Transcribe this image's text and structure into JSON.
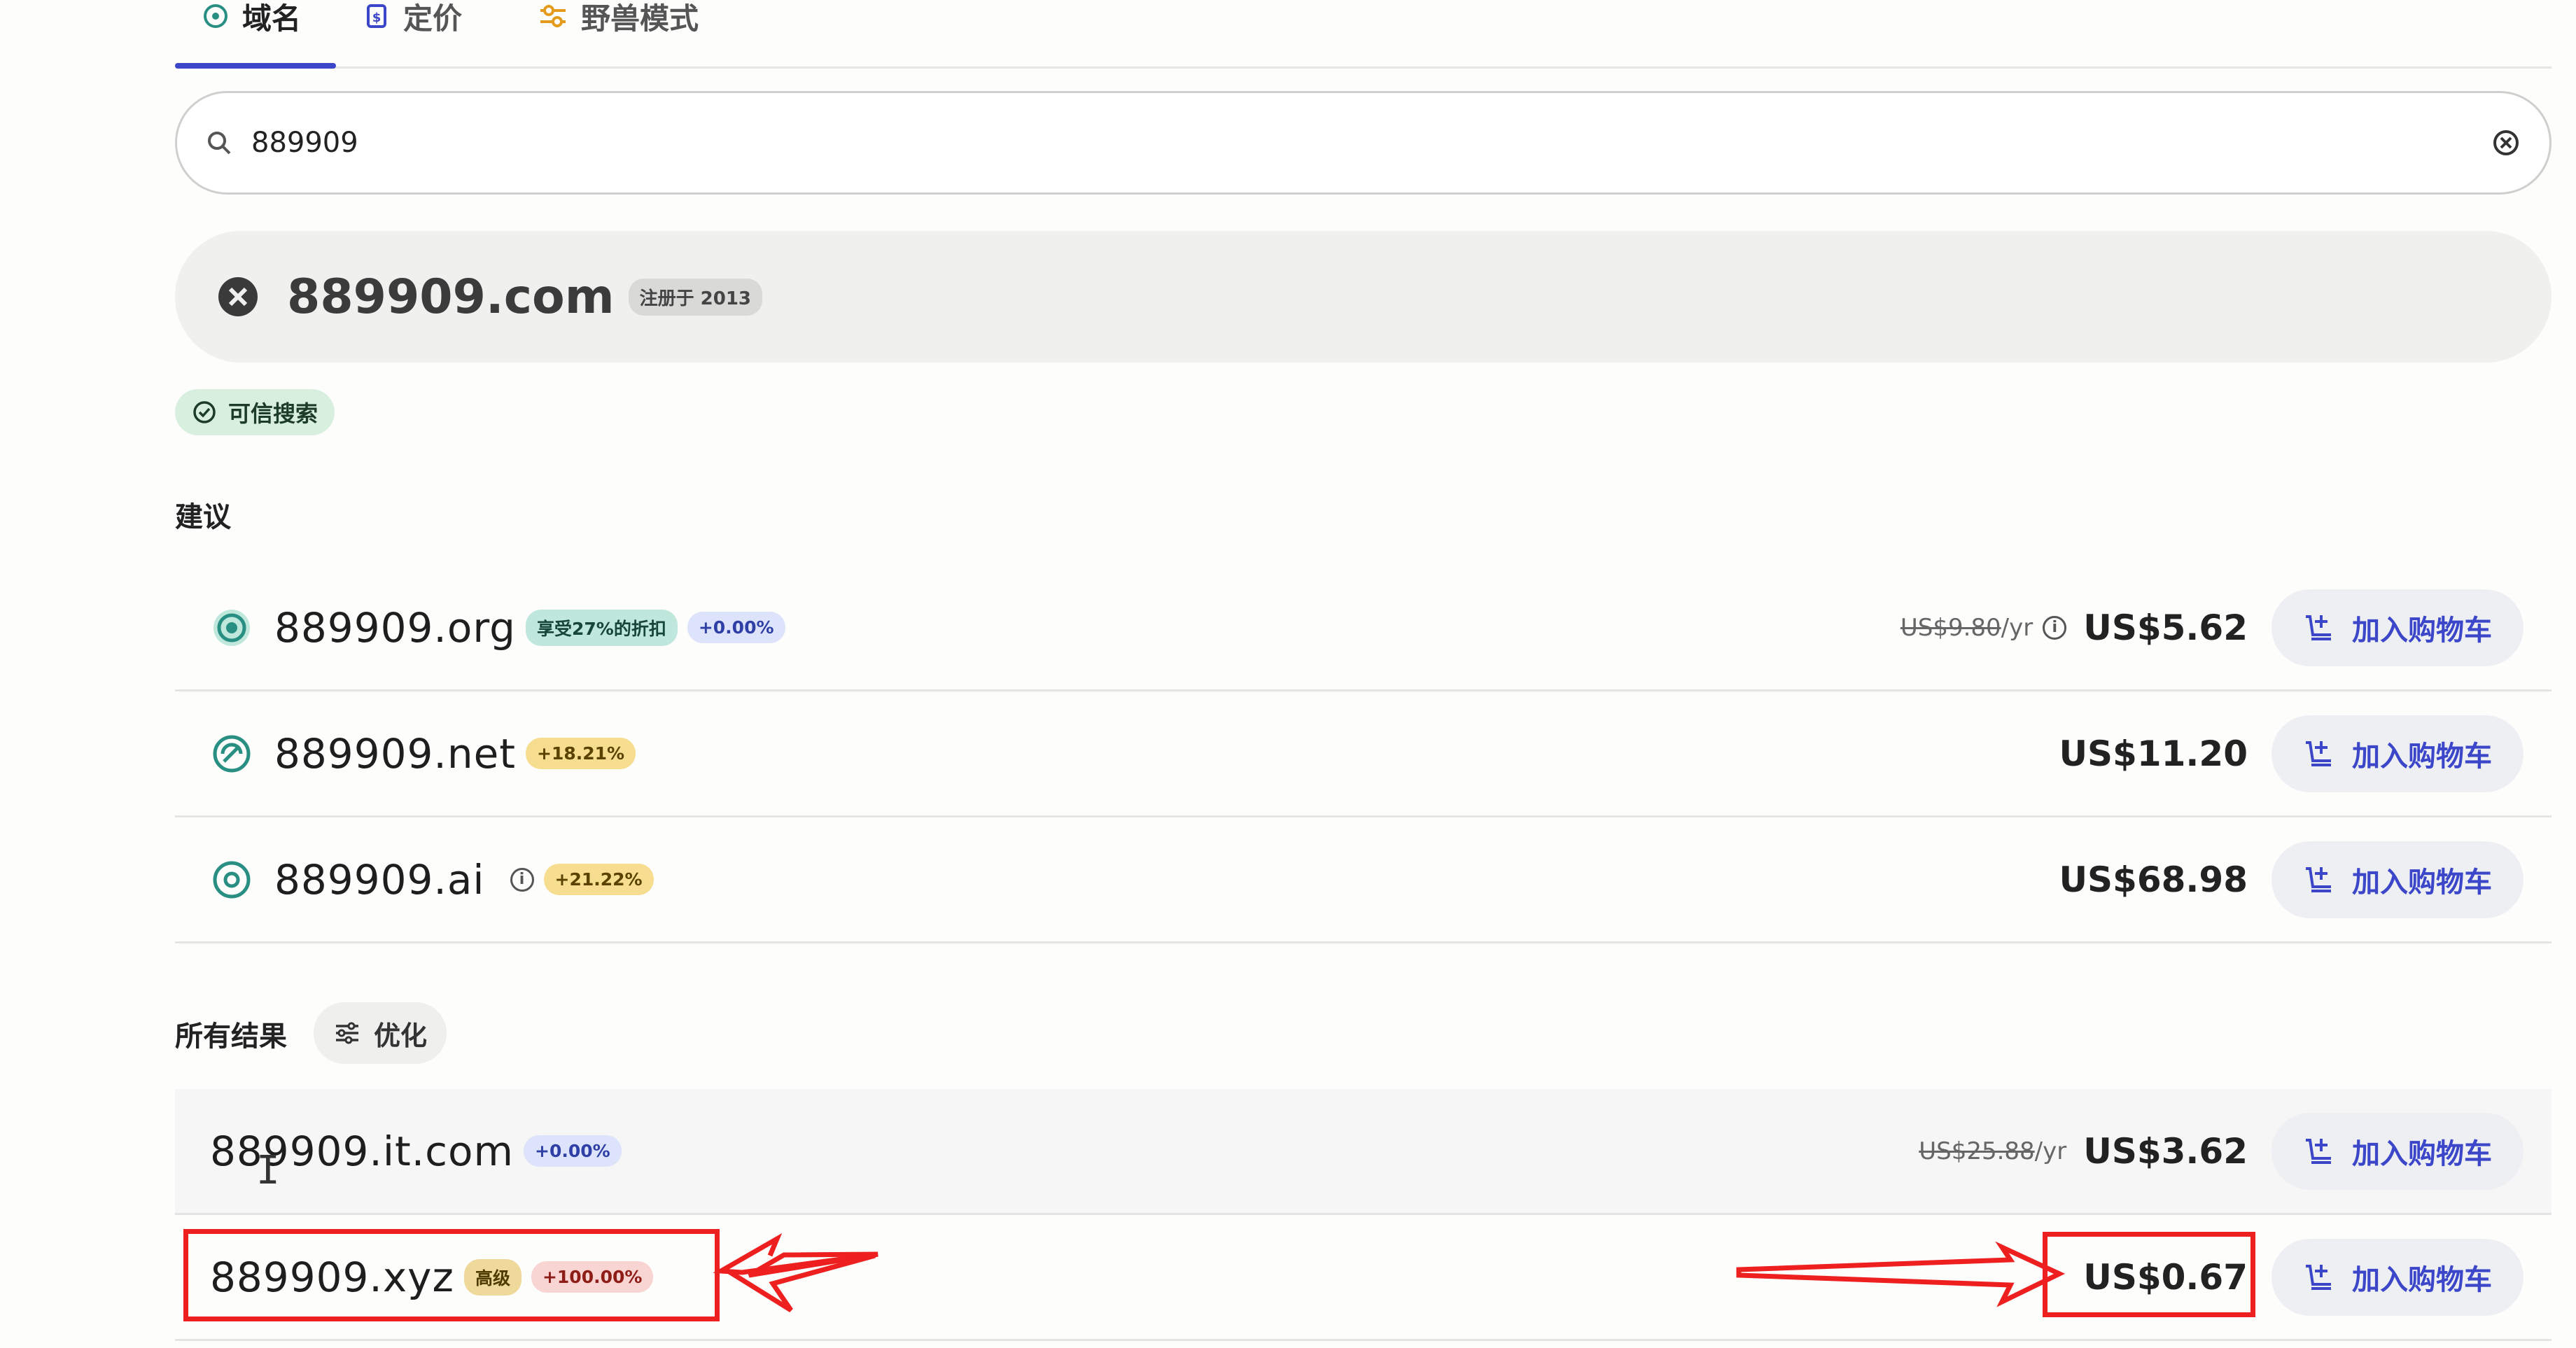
{
  "tabs": [
    {
      "label": "域名",
      "icon": "domain-icon",
      "active": true
    },
    {
      "label": "定价",
      "icon": "pricing-icon",
      "active": false
    },
    {
      "label": "野兽模式",
      "icon": "beast-mode-icon",
      "active": false
    }
  ],
  "search": {
    "value": "889909",
    "placeholder": ""
  },
  "exact_match": {
    "domain": "889909.com",
    "badge": "注册于 2013",
    "status": "unavailable"
  },
  "trusted_search": "可信搜索",
  "suggestions_title": "建议",
  "cart_label": "加入购物车",
  "suggestions": [
    {
      "domain": "889909.org",
      "badges": [
        {
          "text": "享受27%的折扣",
          "kind": "green"
        },
        {
          "text": "+0.00%",
          "kind": "blue"
        }
      ],
      "old_price": "US$9.80",
      "per": "/yr",
      "price": "US$5.62"
    },
    {
      "domain": "889909.net",
      "badges": [
        {
          "text": "+18.21%",
          "kind": "yellow"
        }
      ],
      "old_price": "",
      "per": "",
      "price": "US$11.20"
    },
    {
      "domain": "889909.ai",
      "badges": [
        {
          "text": "+21.22%",
          "kind": "yellow"
        }
      ],
      "old_price": "",
      "per": "",
      "price": "US$68.98"
    }
  ],
  "all_results_title": "所有结果",
  "refine_label": "优化",
  "results": [
    {
      "domain": "889909.it.com",
      "badges": [
        {
          "text": "+0.00%",
          "kind": "blue"
        }
      ],
      "old_price": "US$25.88",
      "per": "/yr",
      "price": "US$3.62"
    },
    {
      "domain": "889909.xyz",
      "badges": [
        {
          "text": "高级",
          "kind": "gold"
        },
        {
          "text": "+100.00%",
          "kind": "red"
        }
      ],
      "old_price": "",
      "per": "",
      "price": "US$0.67"
    }
  ],
  "colors": {
    "accent": "#3b46c9",
    "annotation": "#ee1f1f"
  }
}
